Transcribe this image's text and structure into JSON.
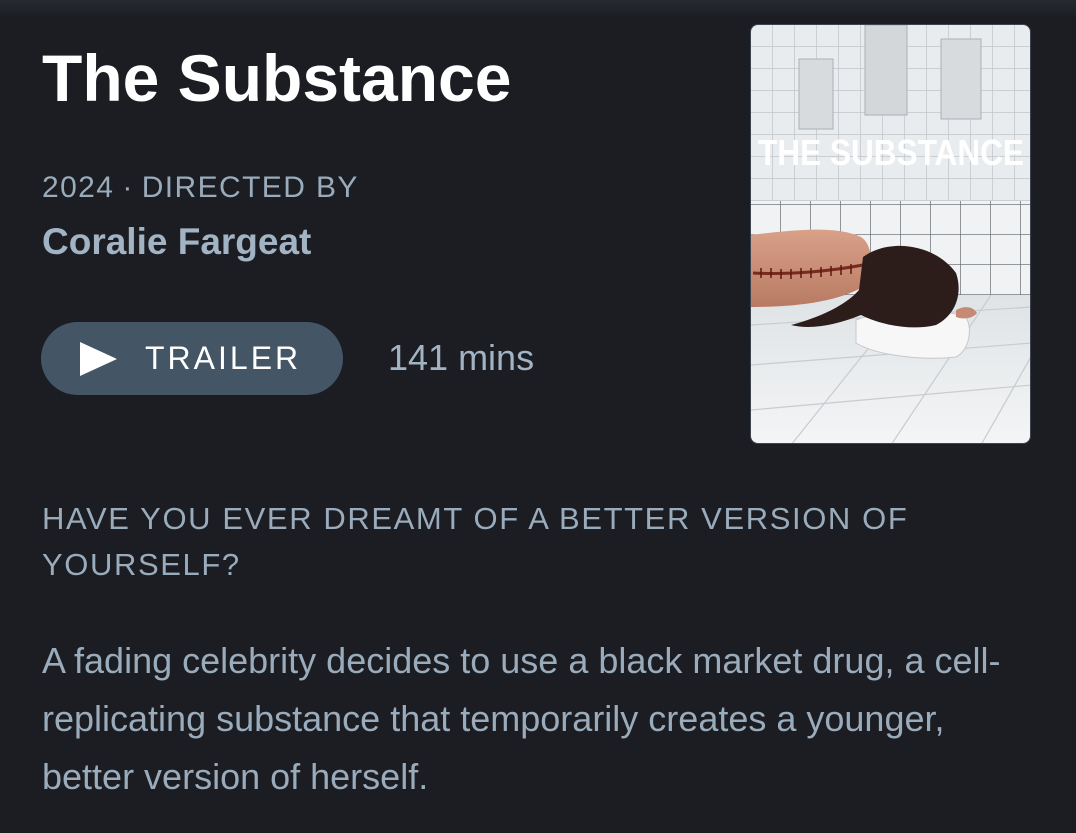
{
  "film": {
    "title": "The Substance",
    "year": "2024",
    "separator": "·",
    "directed_by_label": "DIRECTED BY",
    "director": "Coralie Fargeat",
    "trailer_label": "TRAILER",
    "runtime": "141 mins",
    "poster_title": "THE SUBSTANCE",
    "tagline": "HAVE YOU EVER DREAMT OF A BETTER VERSION OF YOURSELF?",
    "synopsis": "A fading celebrity decides to use a black market drug, a cell-replicating substance that temporarily creates a younger, better version of herself."
  },
  "icons": {
    "trailer": "play-icon"
  },
  "colors": {
    "background": "#1b1d22",
    "title": "#ffffff",
    "muted_text": "#9aabbc",
    "button_bg": "#445566"
  }
}
